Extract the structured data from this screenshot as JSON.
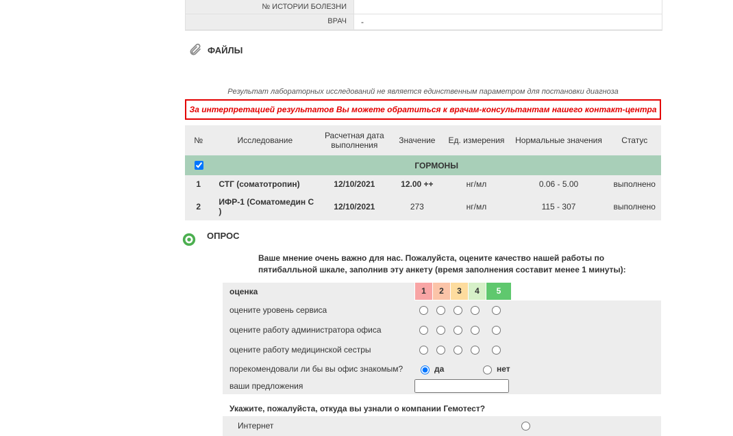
{
  "patient_info": {
    "history_label": "№ ИСТОРИИ БОЛЕЗНИ",
    "history_value": "",
    "doctor_label": "ВРАЧ",
    "doctor_value": "-"
  },
  "files_title": "ФАЙЛЫ",
  "disclaimer": "Результат лабораторных исследований не является единственным параметром для постановки диагноза",
  "red_notice": "За интерпретацией результатов Вы можете обратиться к врачам-консультантам нашего контакт-центра",
  "results": {
    "headers": {
      "num": "№",
      "test": "Исследование",
      "date": "Расчетная дата выполнения",
      "value": "Значение",
      "units": "Ед. измерения",
      "normal": "Нормальные значения",
      "status": "Статус"
    },
    "category": "ГОРМОНЫ",
    "rows": [
      {
        "num": "1",
        "name": "СТГ (соматотропин)",
        "date": "12/10/2021",
        "value": "12.00 ++",
        "units": "нг/мл",
        "normal": "0.06 - 5.00",
        "status": "выполнено"
      },
      {
        "num": "2",
        "name": "ИФР-1 (Соматомедин С )",
        "date": "12/10/2021",
        "value": "273",
        "units": "нг/мл",
        "normal": "115 - 307",
        "status": "выполнено"
      }
    ]
  },
  "survey": {
    "title": "ОПРОС",
    "intro": "Ваше мнение очень важно для нас. Пожалуйста, оцените качество нашей работы по пятибалльной шкале, заполнив эту анкету (время заполнения составит менее 1 минуты):",
    "rating_label": "оценка",
    "scale": [
      "1",
      "2",
      "3",
      "4",
      "5"
    ],
    "questions": [
      "оцените уровень сервиса",
      "оцените работу администратора офиса",
      "оцените работу медицинской сестры"
    ],
    "recommend_q": "порекомендовали ли бы вы офис знакомым?",
    "yes": "да",
    "no": "нет",
    "suggestions_label": "ваши предложения",
    "source_q": "Укажите, пожалуйста, откуда вы узнали о компании Гемотест?",
    "sources": [
      "Интернет"
    ]
  }
}
